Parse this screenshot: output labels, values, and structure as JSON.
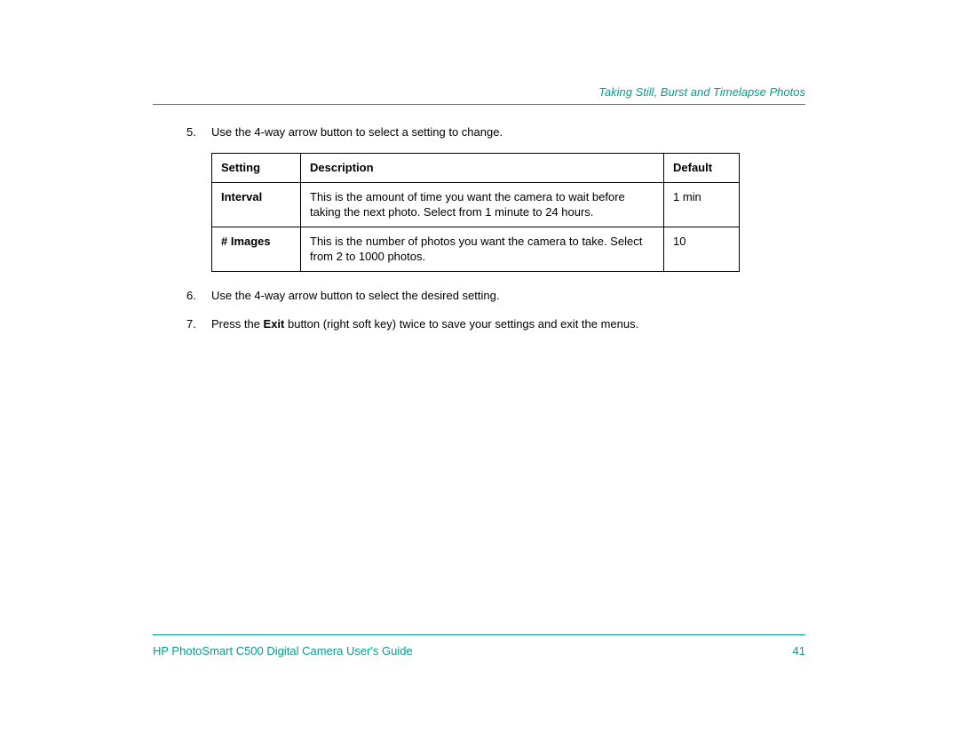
{
  "header": {
    "section_title": "Taking Still, Burst and Timelapse Photos"
  },
  "content": {
    "step5": {
      "num": "5.",
      "text": "Use the 4-way arrow button to select a setting to change."
    },
    "table": {
      "headers": {
        "setting": "Setting",
        "description": "Description",
        "default": "Default"
      },
      "rows": [
        {
          "setting": "Interval",
          "description": "This is the amount of time you want the camera to wait before taking the next photo. Select from 1 minute to 24 hours.",
          "default": "1 min"
        },
        {
          "setting": "# Images",
          "description": "This is the number of photos you want the camera to take. Select from 2 to 1000 photos.",
          "default": "10"
        }
      ]
    },
    "step6": {
      "num": "6.",
      "text": "Use the 4-way arrow button to select the desired setting."
    },
    "step7": {
      "num": "7.",
      "prefix": "Press the ",
      "bold": "Exit",
      "suffix": " button (right soft key) twice to save your settings and exit the menus."
    }
  },
  "footer": {
    "guide_title": "HP PhotoSmart C500 Digital Camera User's Guide",
    "page_number": "41"
  }
}
